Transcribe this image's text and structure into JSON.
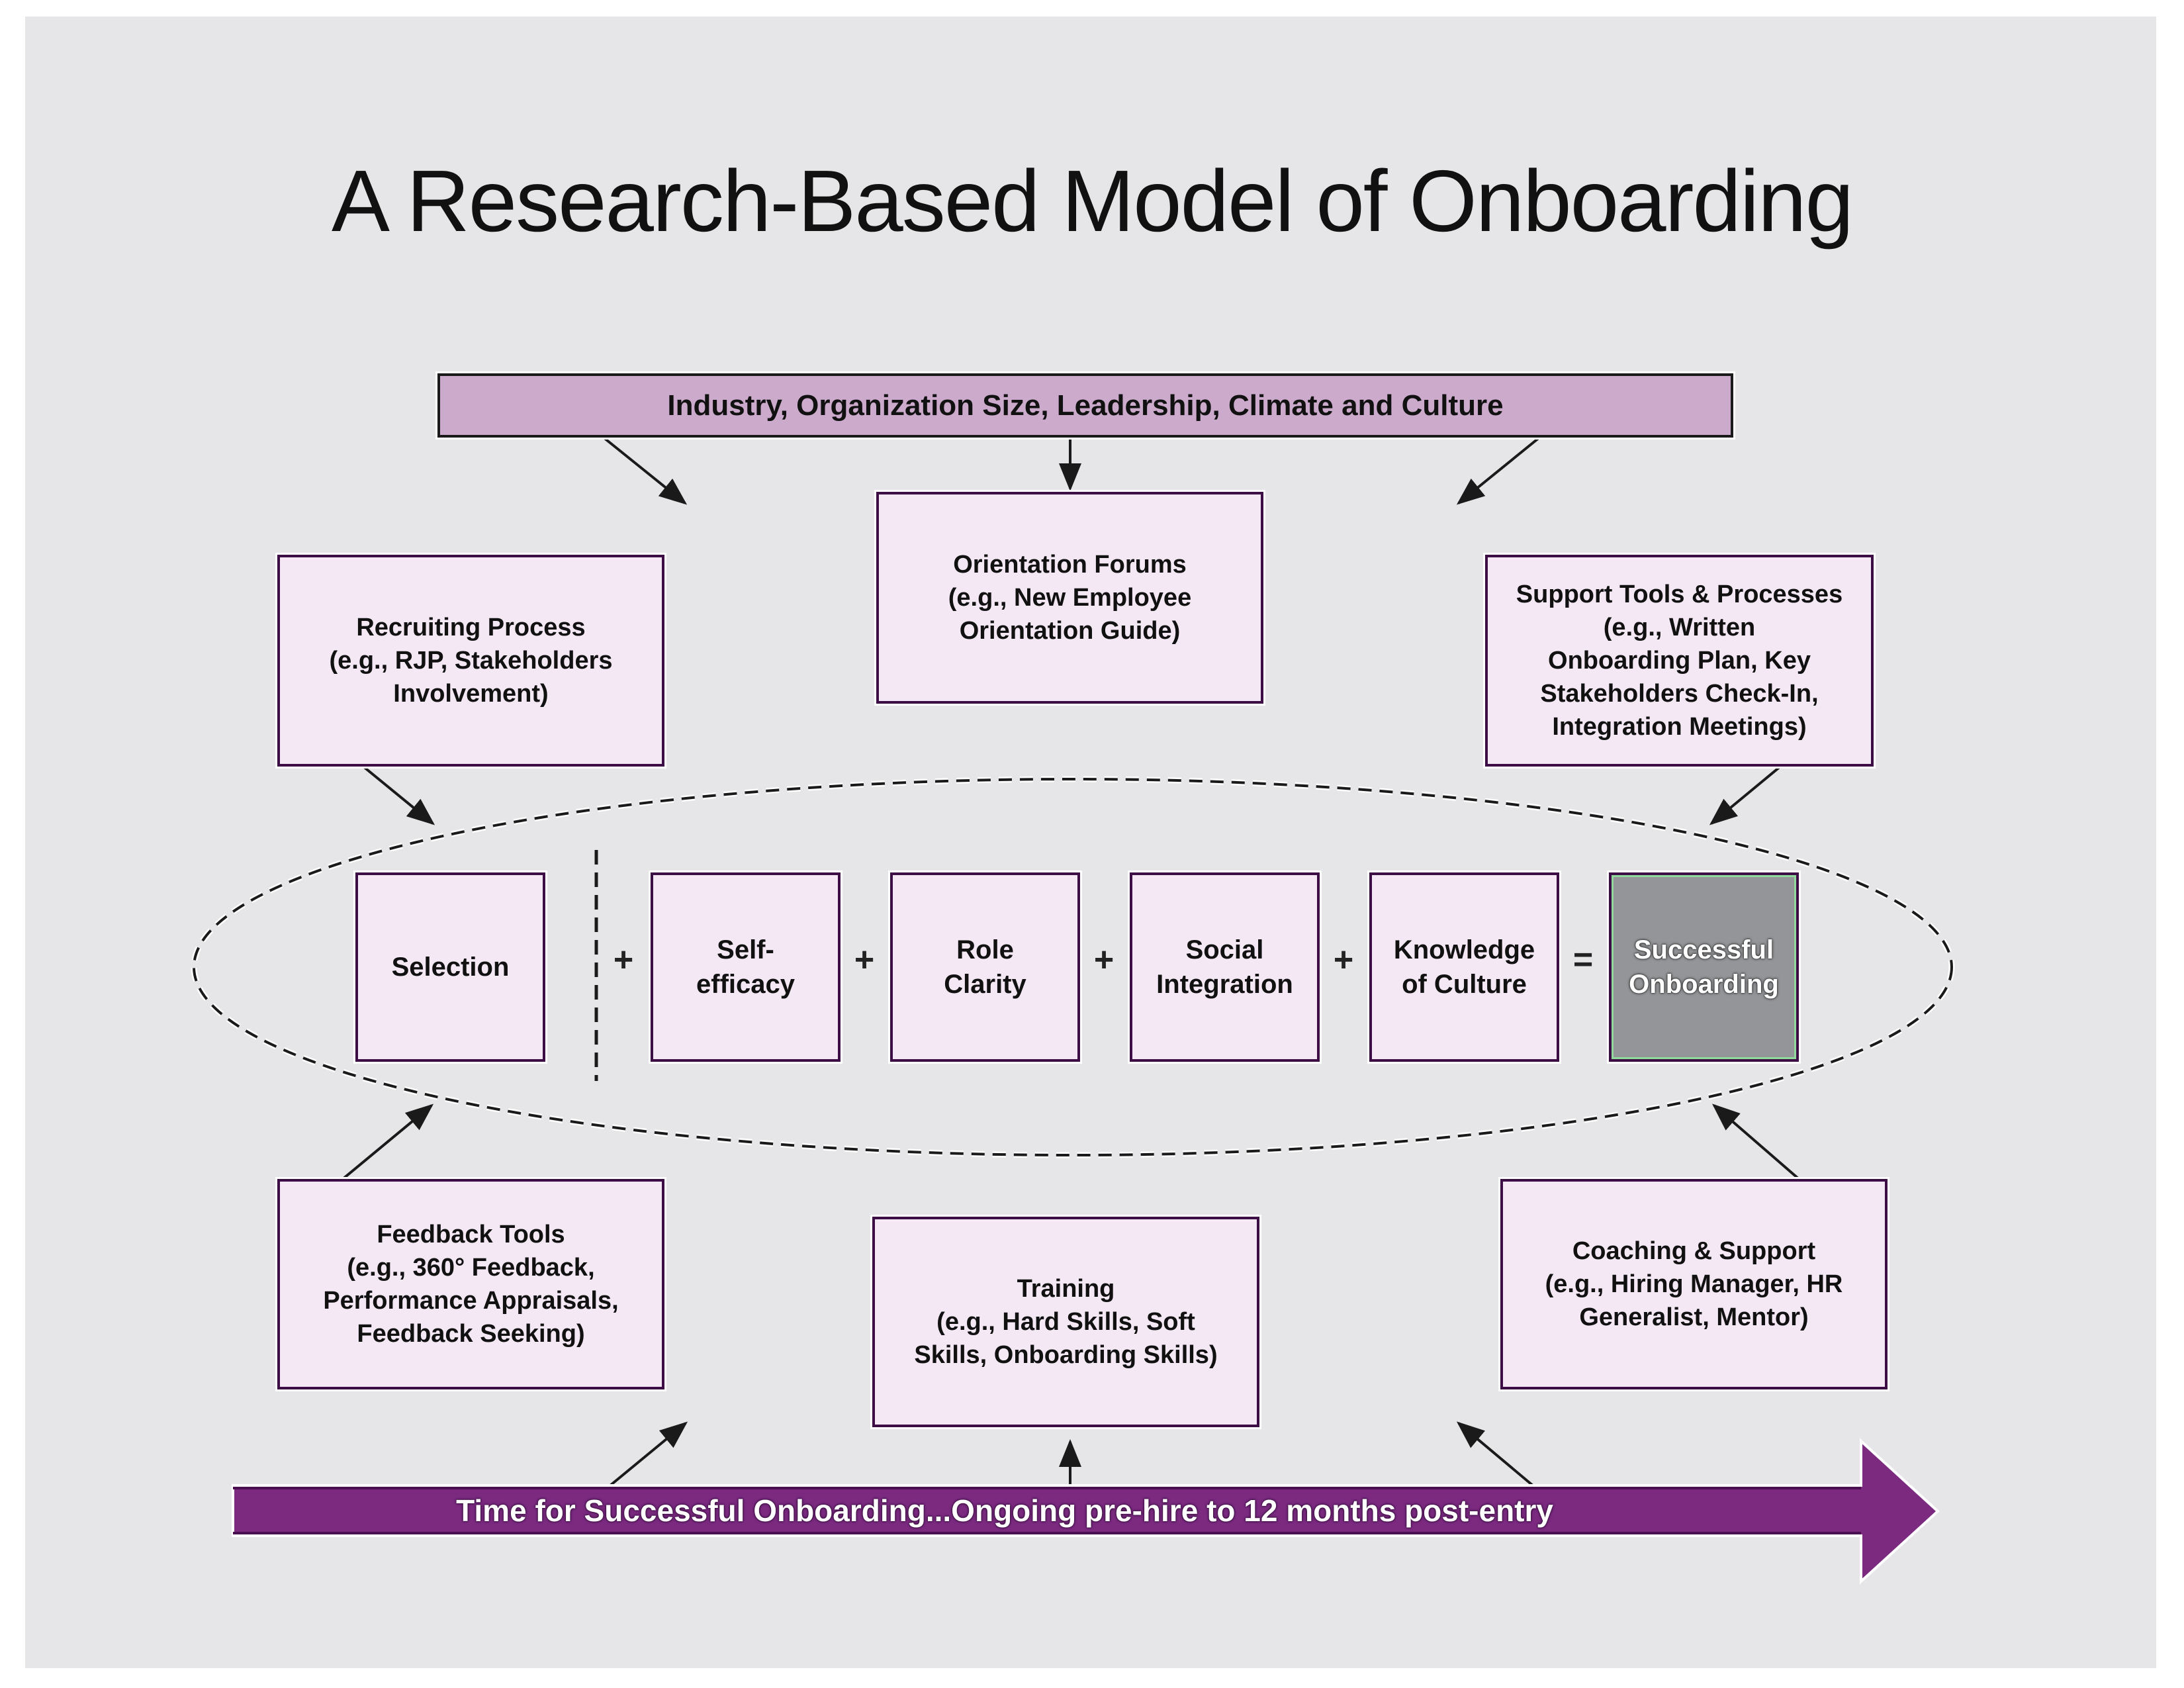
{
  "title": "A Research-Based Model of Onboarding",
  "context_banner": "Industry, Organization Size, Leadership, Climate and Culture",
  "top_boxes": {
    "recruiting": "Recruiting Process\n(e.g., RJP, Stakeholders\nInvolvement)",
    "orientation": "Orientation Forums\n(e.g., New Employee\nOrientation Guide)",
    "support": "Support Tools & Processes\n(e.g., Written\nOnboarding Plan, Key\nStakeholders Check-In,\nIntegration Meetings)"
  },
  "equation": {
    "selection": "Selection",
    "self_efficacy": "Self-\nefficacy",
    "role_clarity": "Role\nClarity",
    "social_integration": "Social\nIntegration",
    "knowledge_of_culture": "Knowledge\nof Culture",
    "successful_onboarding": "Successful\nOnboarding",
    "plus": "+",
    "equals": "="
  },
  "bottom_boxes": {
    "feedback": "Feedback Tools\n(e.g., 360° Feedback,\nPerformance Appraisals,\nFeedback Seeking)",
    "training": "Training\n(e.g., Hard Skills, Soft\nSkills, Onboarding Skills)",
    "coaching": "Coaching & Support\n(e.g., Hiring Manager, HR\nGeneralist, Mentor)"
  },
  "timeline": "Time for Successful Onboarding...Ongoing pre-hire to 12 months post-entry",
  "colors": {
    "background": "#e6e6e8",
    "box_fill": "#f3e8f3",
    "box_border": "#3d0d45",
    "banner_fill": "#cbaacb",
    "success_fill": "#939598",
    "timeline_fill": "#7b2a80"
  }
}
